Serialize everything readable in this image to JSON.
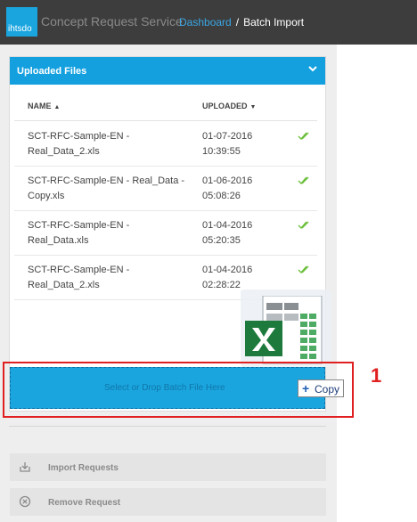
{
  "app": {
    "logo_text": "ihtsdo",
    "title": "Concept Request Service",
    "breadcrumb": {
      "link": "Dashboard",
      "separator": "/",
      "current": "Batch Import"
    }
  },
  "panel": {
    "title": "Uploaded Files",
    "columns": {
      "name": "NAME",
      "uploaded": "UPLOADED"
    },
    "files": [
      {
        "name": "SCT-RFC-Sample-EN - Real_Data_2.xls",
        "date": "01-07-2016",
        "time": "10:39:55",
        "status": "done"
      },
      {
        "name": "SCT-RFC-Sample-EN - Real_Data - Copy.xls",
        "date": "01-06-2016",
        "time": "05:08:26",
        "status": "done"
      },
      {
        "name": "SCT-RFC-Sample-EN - Real_Data.xls",
        "date": "01-04-2016",
        "time": "05:20:35",
        "status": "done"
      },
      {
        "name": "SCT-RFC-Sample-EN - Real_Data_2.xls",
        "date": "01-04-2016",
        "time": "02:28:22",
        "status": "done"
      }
    ]
  },
  "dropzone": {
    "text": "Select or Drop Batch File Here"
  },
  "drag": {
    "tooltip_plus": "+",
    "tooltip_label": "Copy"
  },
  "annotation": {
    "number": "1"
  },
  "actions": {
    "import": "Import Requests",
    "remove": "Remove Request"
  },
  "colors": {
    "topbar": "#3d3d3d",
    "accent": "#14a0df",
    "highlight": "#e02020",
    "check": "#6bbf3a"
  }
}
